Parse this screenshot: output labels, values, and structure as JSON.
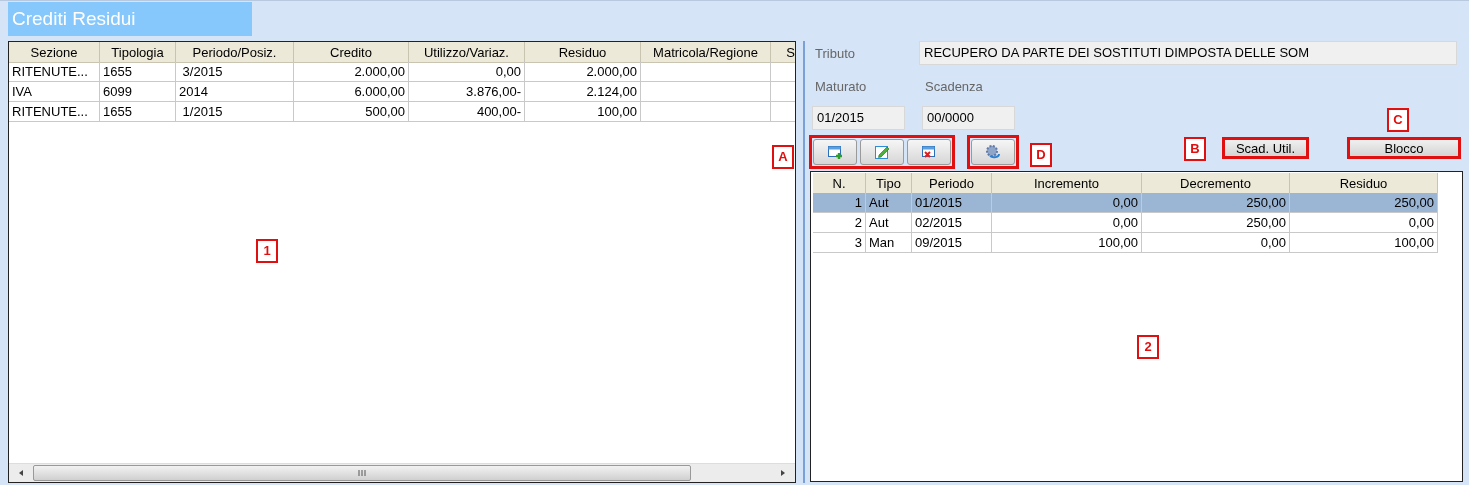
{
  "title": "Crediti Residui",
  "credits_table": {
    "callout": "1",
    "columns": [
      "Sezione",
      "Tipologia",
      "Periodo/Posiz.",
      "Credito",
      "Utilizzo/Variaz.",
      "Residuo",
      "Matricola/Regione",
      "S"
    ],
    "rows": [
      [
        "RITENUTE...",
        "1655",
        " 3/2015",
        "2.000,00",
        "0,00",
        "2.000,00",
        "",
        ""
      ],
      [
        "IVA",
        "6099",
        "2014",
        "6.000,00",
        "3.876,00-",
        "2.124,00",
        "",
        ""
      ],
      [
        "RITENUTE...",
        "1655",
        " 1/2015",
        "500,00",
        "400,00-",
        "100,00",
        "",
        ""
      ]
    ]
  },
  "detail": {
    "tributo_label": "Tributo",
    "tributo_value": "RECUPERO DA PARTE DEI SOSTITUTI DIMPOSTA DELLE SOM",
    "maturato_label": "Maturato",
    "maturato_value": "01/2015",
    "scadenza_label": "Scadenza",
    "scadenza_value": "00/0000"
  },
  "toolbar": {
    "callout": "A",
    "buttons": [
      {
        "kind": "add"
      },
      {
        "kind": "edit"
      },
      {
        "kind": "delete"
      }
    ]
  },
  "refresh_button": {
    "callout": "D"
  },
  "action_buttons": [
    {
      "label": "Scad. Util.",
      "callout": "B"
    },
    {
      "label": "Blocco",
      "callout": "C"
    }
  ],
  "movements_table": {
    "callout": "2",
    "columns": [
      "N.",
      "Tipo",
      "Periodo",
      "Incremento",
      "Decremento",
      "Residuo"
    ],
    "rows": [
      {
        "cells": [
          "1",
          "Aut",
          "01/2015",
          "0,00",
          "250,00",
          "250,00"
        ],
        "selected": true
      },
      {
        "cells": [
          "2",
          "Aut",
          "02/2015",
          "0,00",
          "250,00",
          "0,00"
        ],
        "selected": false
      },
      {
        "cells": [
          "3",
          "Man",
          "09/2015",
          "100,00",
          "0,00",
          "100,00"
        ],
        "selected": false
      }
    ]
  }
}
